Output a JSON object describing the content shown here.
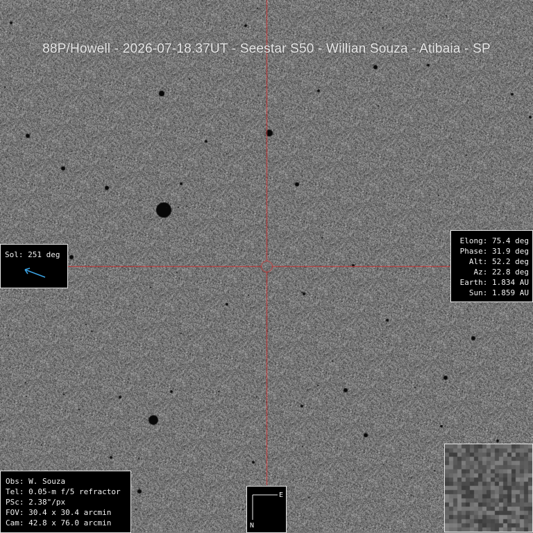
{
  "title": "88P/Howell - 2026-07-18.37UT - Seestar S50 - Willian Souza - Atibaia - SP",
  "sol_panel": {
    "label": "Sol: 251 deg",
    "arrow_color": "#3aa0e0"
  },
  "ephemeris": [
    "Elong: 75.4 deg",
    "Phase: 31.9 deg",
    "  Alt: 52.2 deg",
    "   Az: 22.8 deg",
    "Earth: 1.834 AU",
    "  Sun: 1.859 AU"
  ],
  "observer": [
    "Obs: W. Souza",
    "Tel: 0.05-m f/5 refractor",
    "PSc: 2.38\"/px",
    "FOV: 30.4 x 30.4 arcmin",
    "Cam: 42.8 x 76.0 arcmin"
  ],
  "compass": {
    "east": "E",
    "north": "N"
  },
  "colors": {
    "crosshair": "#c83232",
    "panel_bg": "#000000",
    "panel_text": "#f0f0f0"
  }
}
